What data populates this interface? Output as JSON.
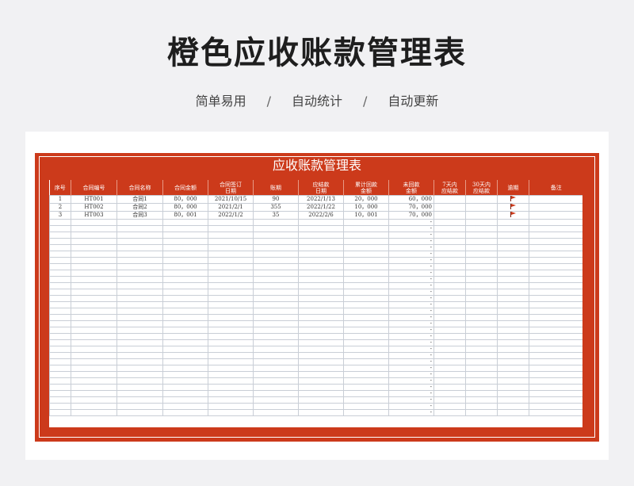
{
  "page": {
    "title": "橙色应收账款管理表",
    "subtitle_items": [
      "简单易用",
      "自动统计",
      "自动更新"
    ],
    "separator": "/"
  },
  "sheet": {
    "title": "应收账款管理表",
    "columns": [
      "序号",
      "合同编号",
      "合同名称",
      "合同金额",
      "合同签订\n日期",
      "账期",
      "应结款\n日期",
      "累计回款\n金额",
      "未回款\n金额",
      "7天内\n应结款",
      "30天内\n应结款",
      "逾期",
      "备注"
    ],
    "rows": [
      [
        "1",
        "HT001",
        "合同1",
        "80，000",
        "2021/10/15",
        "90",
        "2022/1/13",
        "20，000",
        "60，000",
        "",
        "",
        "flag",
        ""
      ],
      [
        "2",
        "HT002",
        "合同2",
        "80，000",
        "2021/2/1",
        "355",
        "2022/1/22",
        "10，000",
        "70，000",
        "",
        "",
        "flag",
        ""
      ],
      [
        "3",
        "HT003",
        "合同3",
        "80，001",
        "2022/1/2",
        "35",
        "2022/2/6",
        "10，001",
        "70，000",
        "",
        "",
        "flag",
        ""
      ]
    ],
    "empty_row_placeholder": "-",
    "empty_row_count": 31,
    "accent_color": "#cc3a1b"
  }
}
